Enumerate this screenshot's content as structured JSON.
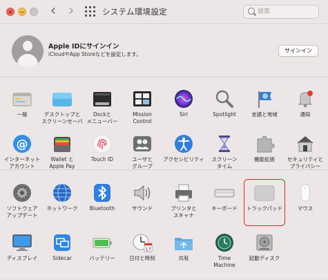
{
  "window": {
    "title": "システム環境設定"
  },
  "toolbar": {
    "back": "‹",
    "forward": "›",
    "search_placeholder": "検索"
  },
  "apple_id": {
    "title": "Apple IDにサインイン",
    "subtitle": "iCloudやApp Storeなどを設定します。",
    "signin_label": "サインイン"
  },
  "section1": {
    "row1": [
      {
        "id": "general",
        "label": "一般",
        "icon": "general-icon"
      },
      {
        "id": "desktop",
        "label": "デスクトップと\nスクリーンセーバ",
        "icon": "desktop-icon"
      },
      {
        "id": "dock",
        "label": "Dockと\nメニューバー",
        "icon": "dock-icon"
      },
      {
        "id": "mission",
        "label": "Mission\nControl",
        "icon": "mission-control-icon"
      },
      {
        "id": "siri",
        "label": "Siri",
        "icon": "siri-icon"
      },
      {
        "id": "spotlight",
        "label": "Spotlight",
        "icon": "spotlight-icon"
      },
      {
        "id": "language",
        "label": "言語と地域",
        "icon": "flag-icon"
      },
      {
        "id": "notifications",
        "label": "通知",
        "icon": "bell-icon"
      }
    ],
    "row2": [
      {
        "id": "internet",
        "label": "インターネット\nアカウント",
        "icon": "at-icon"
      },
      {
        "id": "wallet",
        "label": "Wallet と\nApple Pay",
        "icon": "wallet-icon"
      },
      {
        "id": "touchid",
        "label": "Touch ID",
        "icon": "fingerprint-icon"
      },
      {
        "id": "users",
        "label": "ユーザと\nグループ",
        "icon": "users-icon"
      },
      {
        "id": "accessibility",
        "label": "アクセシビリティ",
        "icon": "accessibility-icon"
      },
      {
        "id": "screentime",
        "label": "スクリーン\nタイム",
        "icon": "hourglass-icon"
      },
      {
        "id": "extensions",
        "label": "機能拡張",
        "icon": "puzzle-icon"
      },
      {
        "id": "security",
        "label": "セキュリティと\nプライバシー",
        "icon": "house-icon"
      }
    ]
  },
  "section2": {
    "row1": [
      {
        "id": "software",
        "label": "ソフトウェア\nアップデート",
        "icon": "gear-icon"
      },
      {
        "id": "network",
        "label": "ネットワーク",
        "icon": "globe-icon"
      },
      {
        "id": "bluetooth",
        "label": "Bluetooth",
        "icon": "bluetooth-icon"
      },
      {
        "id": "sound",
        "label": "サウンド",
        "icon": "speaker-icon"
      },
      {
        "id": "printers",
        "label": "プリンタと\nスキャナ",
        "icon": "printer-icon"
      },
      {
        "id": "keyboard",
        "label": "キーボード",
        "icon": "keyboard-icon"
      },
      {
        "id": "trackpad",
        "label": "トラックパッド",
        "icon": "trackpad-icon"
      },
      {
        "id": "mouse",
        "label": "マウス",
        "icon": "mouse-icon"
      }
    ],
    "row2": [
      {
        "id": "displays",
        "label": "ディスプレイ",
        "icon": "display-icon"
      },
      {
        "id": "sidecar",
        "label": "Sidecar",
        "icon": "sidecar-icon"
      },
      {
        "id": "battery",
        "label": "バッテリー",
        "icon": "battery-icon"
      },
      {
        "id": "datetime",
        "label": "日付と時刻",
        "icon": "clock-calendar-icon"
      },
      {
        "id": "sharing",
        "label": "共有",
        "icon": "sharing-folder-icon"
      },
      {
        "id": "timemachine",
        "label": "Time\nMachine",
        "icon": "time-machine-icon"
      },
      {
        "id": "startup",
        "label": "起動ディスク",
        "icon": "disk-icon"
      }
    ]
  },
  "calendar_icon_day": "17",
  "colors": {
    "selected_outline": "#e0252a",
    "accent": "#1f7ae0"
  }
}
